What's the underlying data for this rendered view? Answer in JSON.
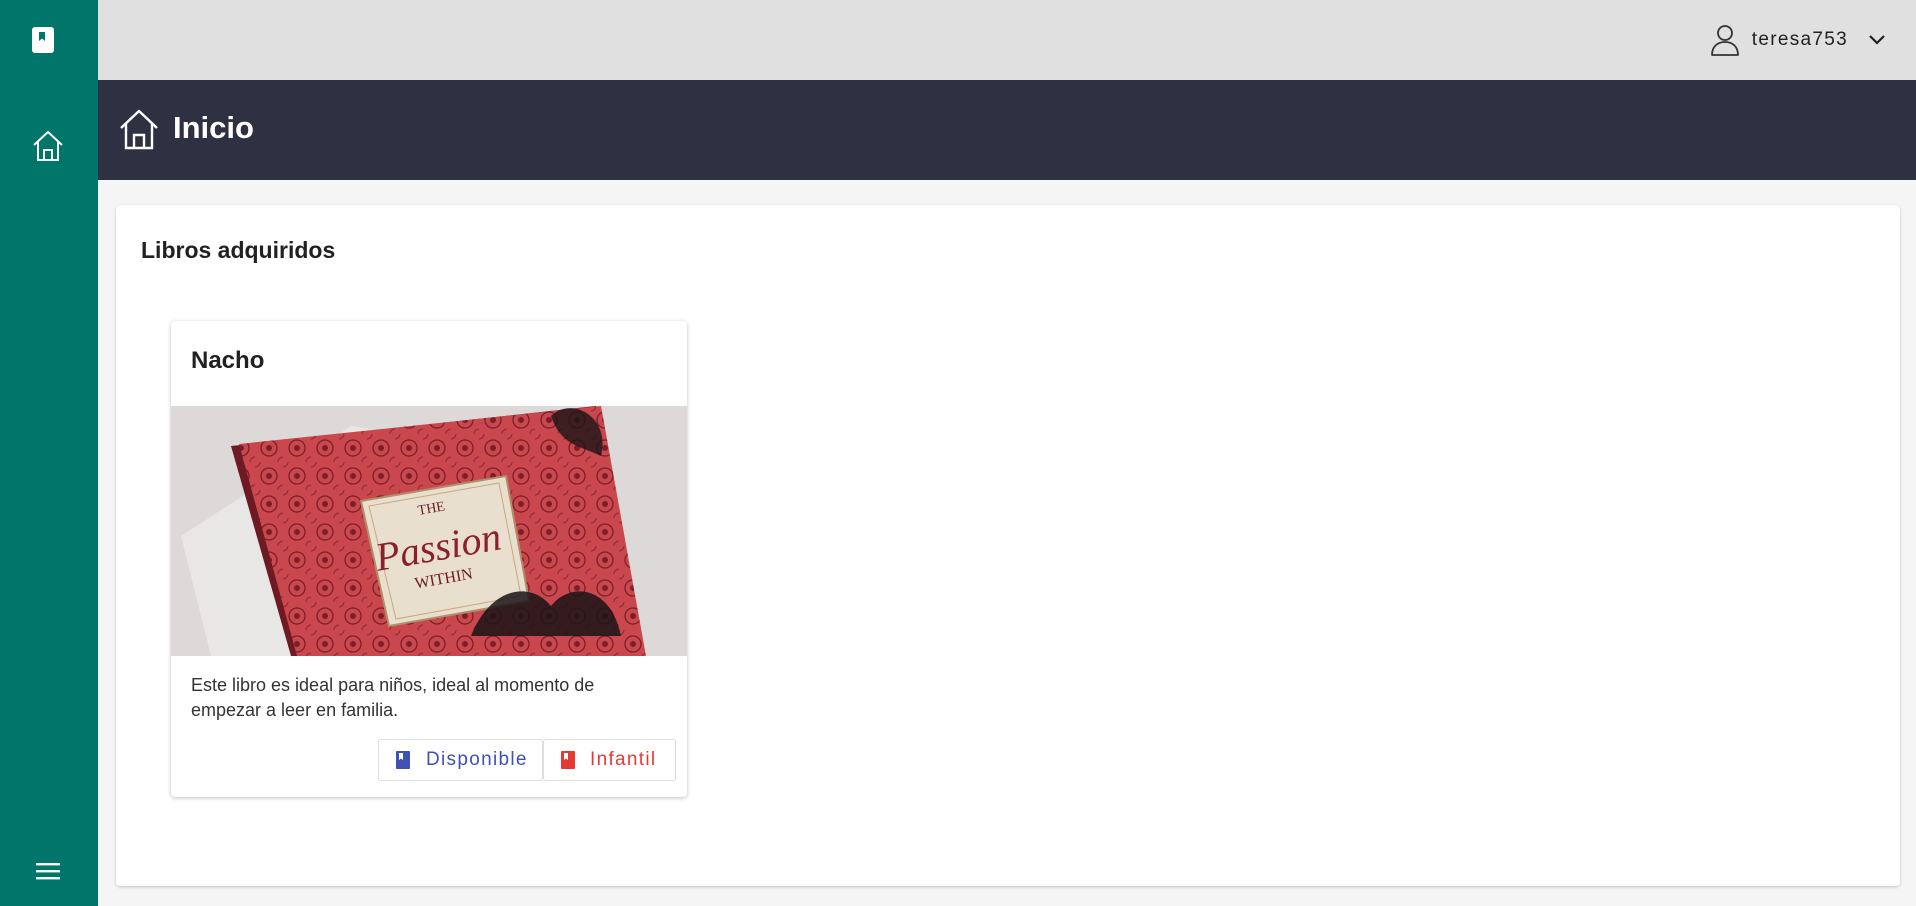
{
  "sidebar": {
    "logo_icon": "book-icon",
    "home_icon": "home-icon",
    "menu_icon": "hamburger-menu-icon",
    "background": "#00766a"
  },
  "topbar": {
    "username": "teresa753",
    "user_icon": "user-icon",
    "dropdown_icon": "chevron-down-icon"
  },
  "header": {
    "title": "Inicio",
    "icon": "home-icon",
    "background": "#2d3142"
  },
  "main": {
    "section_title": "Libros adquiridos",
    "books": [
      {
        "title": "Nacho",
        "image_alt_icon": "book-cover-image",
        "description": "Este libro es ideal para niños, ideal al momento de empezar a leer en familia.",
        "status_label": "Disponible",
        "status_color": "#3f51b5",
        "category_label": "Infantil",
        "category_color": "#e53935"
      }
    ]
  }
}
